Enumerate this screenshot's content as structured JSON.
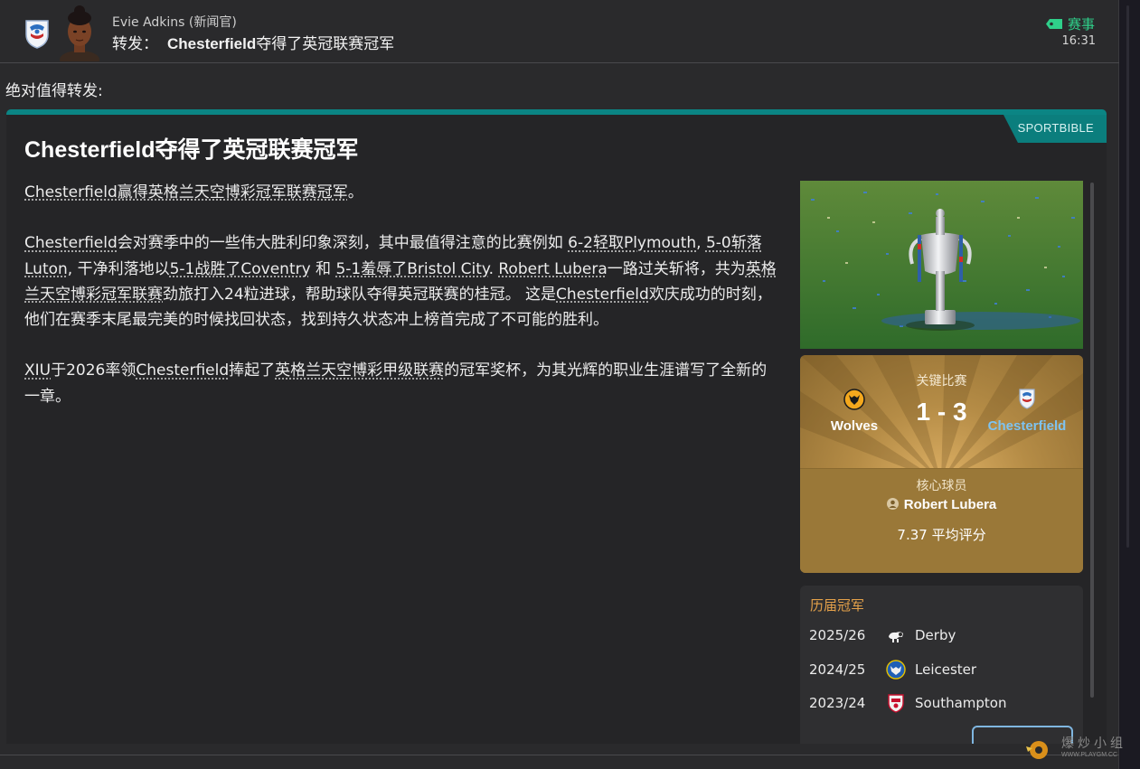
{
  "header": {
    "sender": "Evie Adkins (新闻官)",
    "subject_prefix": "转发：",
    "subject_en": "Chesterfield",
    "subject_cn": "夺得了英冠联赛冠军",
    "tag": "赛事",
    "time": "16:31",
    "tag_color": "#2fcf8a"
  },
  "intro": "绝对值得转发:",
  "card": {
    "source": "SPORTBIBLE",
    "accent_color": "#0b8584",
    "headline_en": "Chesterfield",
    "headline_cn": "夺得了英冠联赛冠军",
    "p1": {
      "a": "Chesterfield赢得英格兰天空博彩冠军联赛冠军",
      "b": "。"
    },
    "p2": {
      "t1": "Chesterfield",
      "t2": "会对赛季中的一些伟大胜利印象深刻，其中最值得注意的比赛例如 ",
      "t3": "6-2轻取Plymouth",
      "t4": ", ",
      "t5": "5-0斩落Luton",
      "t6": ", 干净利落地以",
      "t7": "5-1战胜了Coventry",
      "t8": " 和 ",
      "t9": "5-1羞辱了Bristol City",
      "t10": ". ",
      "t11": "Robert Lubera",
      "t12": "一路过关斩将，共为",
      "t13": "英格兰天空博彩冠军联赛",
      "t14": "劲旅打入24粒进球，帮助球队夺得英冠联赛的桂冠。 这是",
      "t15": "Chesterfield",
      "t16": "欢庆成功的时刻，他们在赛季末尾最完美的时候找回状态，找到持久状态冲上榜首完成了不可能的胜利。"
    },
    "p3": {
      "t1": "XIU",
      "t2": "于2026率领",
      "t3": "Chesterfield",
      "t4": "捧起了",
      "t5": "英格兰天空博彩甲级联赛",
      "t6": "的冠军奖杯，为其光辉的职业生涯谱写了全新的一章。"
    }
  },
  "key_match": {
    "label": "关键比赛",
    "home": "Wolves",
    "score": "1 - 3",
    "away": "Chesterfield",
    "away_color": "#7ec3f0"
  },
  "key_player": {
    "label": "核心球员",
    "name": "Robert Lubera",
    "rating": "7.37 平均评分"
  },
  "past_winners": {
    "title": "历届冠军",
    "rows": [
      {
        "season": "2025/26",
        "club": "Derby",
        "badge_icon": "ram-badge-icon"
      },
      {
        "season": "2024/25",
        "club": "Leicester",
        "badge_icon": "fox-badge-icon"
      },
      {
        "season": "2023/24",
        "club": "Southampton",
        "badge_icon": "saints-badge-icon"
      }
    ]
  },
  "watermark": {
    "text": "爆炒小组",
    "url": "WWW.PLAYGM.CC"
  }
}
